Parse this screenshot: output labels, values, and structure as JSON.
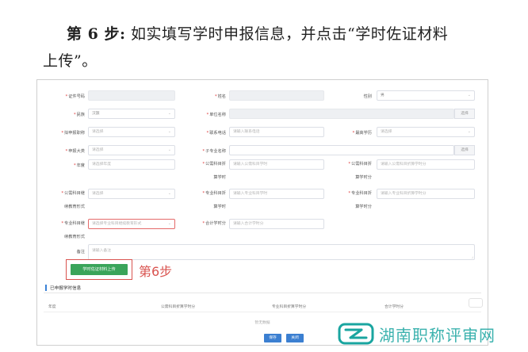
{
  "heading": {
    "step_label": "第 6 步:",
    "text_1": "如实填写学时申报信息，并点击“学时佐证材料",
    "text_2": "上传”。"
  },
  "form": {
    "rows": [
      {
        "fields": [
          {
            "label": "证件号码",
            "required": true,
            "value": "",
            "blurred": true
          },
          {
            "label": "姓名",
            "required": true,
            "value": "",
            "blurred": true
          },
          {
            "label": "性别",
            "required": false,
            "value": "男",
            "select": true
          }
        ]
      },
      {
        "fields": [
          {
            "label": "民族",
            "required": true,
            "value": "汉族",
            "select": true
          },
          {
            "label": "单位名称",
            "required": true,
            "value": "",
            "picker": "选择"
          },
          {
            "label": "",
            "required": false,
            "value": ""
          }
        ]
      },
      {
        "fields": [
          {
            "label": "拟申报职称",
            "required": true,
            "placeholder": "请选择",
            "select": true
          },
          {
            "label": "联系电话",
            "required": true,
            "placeholder": "请输入联系电话"
          },
          {
            "label": "最高学历",
            "required": true,
            "placeholder": "请选择",
            "select": true
          }
        ]
      },
      {
        "fields": [
          {
            "label": "申报大类",
            "required": true,
            "placeholder": "请选择",
            "select": true
          },
          {
            "label": "子专业名称",
            "required": true,
            "value": "",
            "picker": "选择"
          },
          {
            "label": "",
            "required": false,
            "value": ""
          }
        ]
      },
      {
        "fields": [
          {
            "label": "年度",
            "required": true,
            "placeholder": "请选择年度",
            "select": false
          },
          {
            "label": "公需科目折",
            "label_2": "算学时",
            "required": true,
            "placeholder": "请输入公需科目学时"
          },
          {
            "label": "公需科目折",
            "label_2": "算学时分",
            "required": true,
            "placeholder": "请输入公需科目折算学时分"
          }
        ]
      },
      {
        "fields": [
          {
            "label": "公需科目继",
            "label_2": "续教育形式",
            "required": true,
            "placeholder": "请选择",
            "select": true
          },
          {
            "label": "专业科目折",
            "label_2": "算学时",
            "required": true,
            "placeholder": "请输入专业科目学时"
          },
          {
            "label": "专业科目折",
            "label_2": "算学时分",
            "required": true,
            "placeholder": "请输入专业科目折算学时分"
          }
        ]
      },
      {
        "fields": [
          {
            "label": "专业科目继",
            "label_2": "续教育形式",
            "required": true,
            "placeholder": "请选择专业科目继续教育形式",
            "select": true,
            "error": true
          },
          {
            "label": "合计学时分",
            "required": true,
            "placeholder": "请输入合计学时分"
          },
          {
            "label": "",
            "required": false,
            "value": ""
          }
        ]
      }
    ],
    "remark": {
      "label": "备注",
      "placeholder": "请输入备注"
    },
    "upload_button": "学时佐证材料上传",
    "step_tag": "第6步"
  },
  "declared": {
    "title": "已申报学时信息",
    "columns": [
      "年度",
      "公需科目折算学时分",
      "专业科目折算学时分",
      "合计学时分"
    ],
    "empty_text": "暂无数据",
    "save_button": "保存",
    "close_button": "关闭"
  },
  "watermark": {
    "text": "湖南职称评审网"
  },
  "colors": {
    "upload_green": "#3aa45a",
    "highlight_red": "#d9534f",
    "primary_blue": "#3b7fd1",
    "watermark_teal": "#1aa5a0"
  }
}
